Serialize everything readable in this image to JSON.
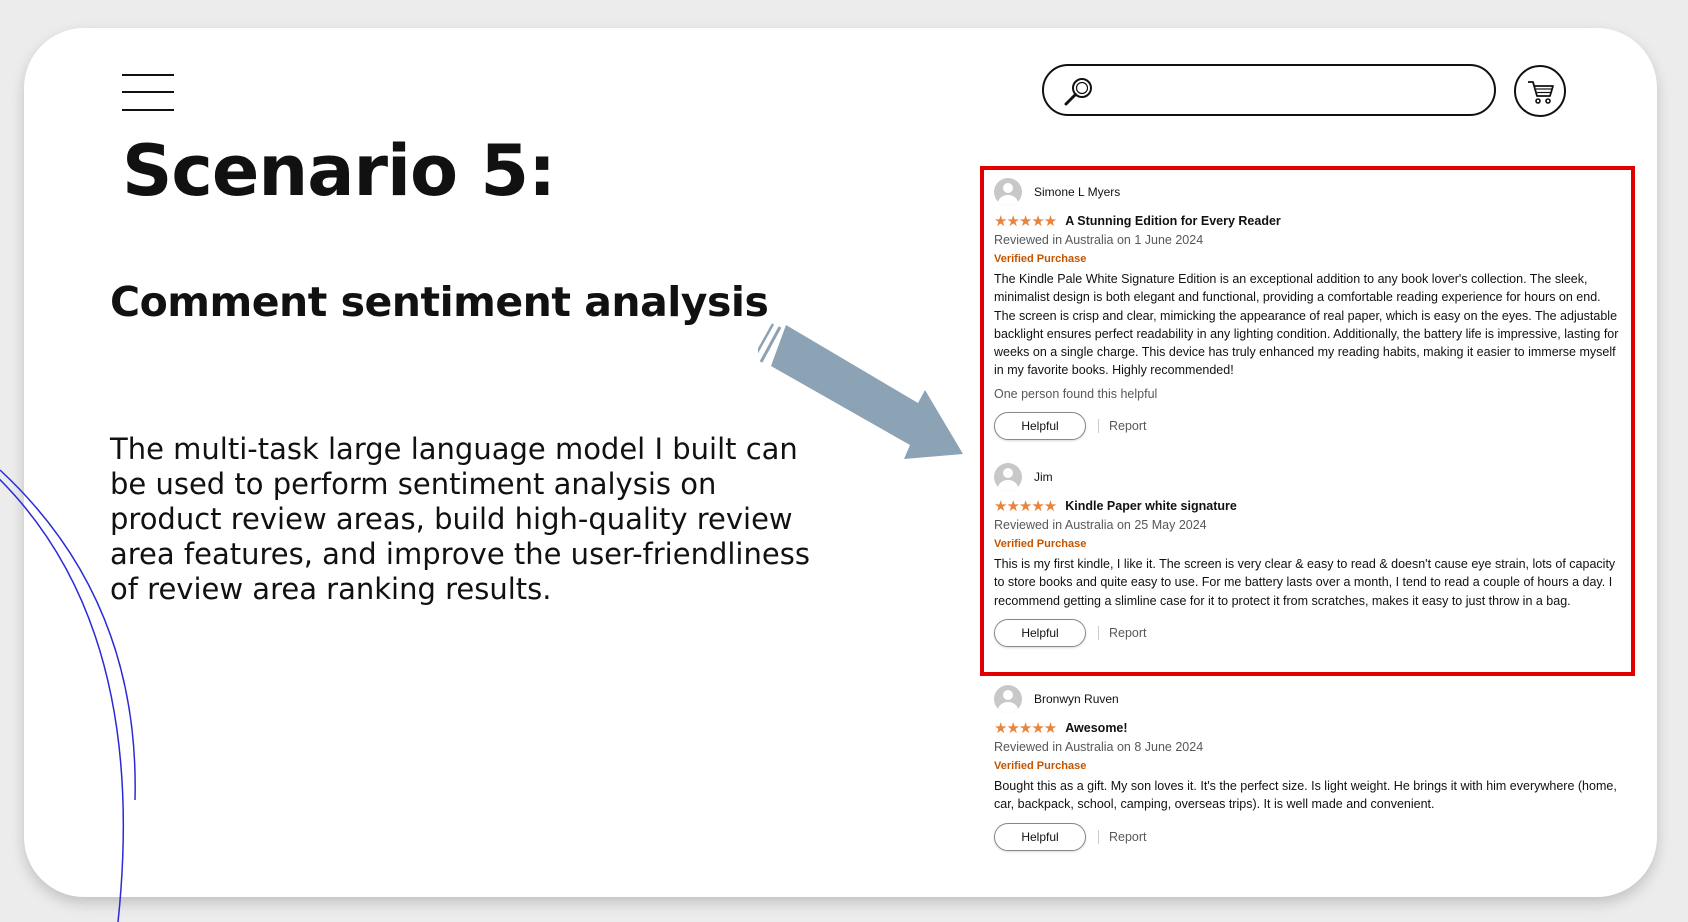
{
  "slide": {
    "title": "Scenario 5:",
    "subtitle": "Comment sentiment analysis",
    "description": "The multi-task large language model I built can be used to perform sentiment analysis on product review areas, build high-quality review area features, and improve the user-friendliness of review area ranking results."
  },
  "header": {
    "menu_icon": "hamburger-menu-icon",
    "search_icon": "magnifier-icon",
    "search_placeholder": "",
    "cart_icon": "shopping-cart-icon"
  },
  "colors": {
    "highlight": "#e00000",
    "arrow": "#8ca2b5",
    "stars": "#e8843c",
    "verified": "#c45500",
    "deco_arc": "#2a2ad8"
  },
  "reviews": [
    {
      "author": "Simone L Myers",
      "stars": "★★★★★",
      "title": "A Stunning Edition for Every Reader",
      "meta": "Reviewed in Australia on 1 June 2024",
      "verified": "Verified Purchase",
      "body": "The Kindle Pale White Signature Edition is an exceptional addition to any book lover's collection. The sleek, minimalist design is both elegant and functional, providing a comfortable reading experience for hours on end. The screen is crisp and clear, mimicking the appearance of real paper, which is easy on the eyes. The adjustable backlight ensures perfect readability in any lighting condition. Additionally, the battery life is impressive, lasting for weeks on a single charge. This device has truly enhanced my reading habits, making it easier to immerse myself in my favorite books. Highly recommended!",
      "helpful_count": "One person found this helpful",
      "helpful_label": "Helpful",
      "report_label": "Report"
    },
    {
      "author": "Jim",
      "stars": "★★★★★",
      "title": "Kindle Paper white signature",
      "meta": "Reviewed in Australia on 25 May 2024",
      "verified": "Verified Purchase",
      "body": "This is my first kindle, I like it. The screen is very clear & easy to read & doesn't cause eye strain, lots of capacity to store books and quite easy to use. For me battery lasts over a month, I tend to read a couple of hours a day. I recommend getting a slimline case for it to protect it from scratches, makes it easy to just throw in a bag.",
      "helpful_label": "Helpful",
      "report_label": "Report"
    },
    {
      "author": "Bronwyn Ruven",
      "stars": "★★★★★",
      "title": "Awesome!",
      "meta": "Reviewed in Australia on 8 June 2024",
      "verified": "Verified Purchase",
      "body": "Bought this as a gift. My son loves it. It's the perfect size. Is light weight. He brings it with him everywhere (home, car, backpack, school, camping, overseas trips). It is well made and convenient.",
      "helpful_label": "Helpful",
      "report_label": "Report"
    }
  ]
}
